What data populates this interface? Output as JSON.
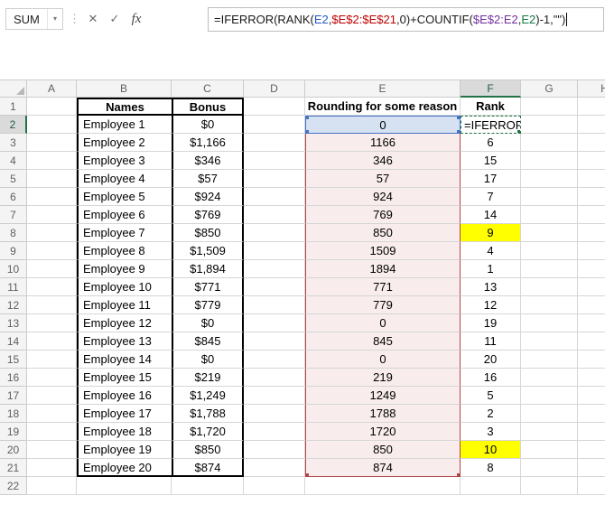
{
  "formula_bar": {
    "name_box_value": "SUM",
    "dropdown_icon": "▾",
    "splitter_icon": "⋮",
    "cancel_label": "✕",
    "enter_label": "✓",
    "insert_function_label": "fx",
    "formula_segments": [
      {
        "text": "=IFERROR(RANK(",
        "color": "#1a1a1a"
      },
      {
        "text": "E2",
        "color": "#2457c5"
      },
      {
        "text": ",",
        "color": "#1a1a1a"
      },
      {
        "text": "$E$2:$E$21",
        "color": "#c00000"
      },
      {
        "text": ",0)+COUNTIF(",
        "color": "#1a1a1a"
      },
      {
        "text": "$E$2:E2",
        "color": "#7030a0"
      },
      {
        "text": ",",
        "color": "#1a1a1a"
      },
      {
        "text": "E2",
        "color": "#107c41"
      },
      {
        "text": ")-1,\"\")",
        "color": "#1a1a1a"
      }
    ]
  },
  "grid": {
    "column_headers": [
      "A",
      "B",
      "C",
      "D",
      "E",
      "F",
      "G",
      "H"
    ],
    "row_headers": [
      "1",
      "2",
      "3",
      "4",
      "5",
      "6",
      "7",
      "8",
      "9",
      "10",
      "11",
      "12",
      "13",
      "14",
      "15",
      "16",
      "17",
      "18",
      "19",
      "20",
      "21",
      "22"
    ],
    "selected_column": "F",
    "selected_row_header": "2",
    "headers": {
      "names": "Names",
      "bonus": "Bonus",
      "rounding": "Rounding for some reason",
      "rank": "Rank"
    },
    "rows": [
      {
        "row": "2",
        "name": "Employee 1",
        "bonus": "$0",
        "rounded": "0",
        "rank": "=IFERROR",
        "editing": true,
        "e_highlight": "blue"
      },
      {
        "row": "3",
        "name": "Employee 2",
        "bonus": "$1,166",
        "rounded": "1166",
        "rank": "6"
      },
      {
        "row": "4",
        "name": "Employee 3",
        "bonus": "$346",
        "rounded": "346",
        "rank": "15"
      },
      {
        "row": "5",
        "name": "Employee 4",
        "bonus": "$57",
        "rounded": "57",
        "rank": "17"
      },
      {
        "row": "6",
        "name": "Employee 5",
        "bonus": "$924",
        "rounded": "924",
        "rank": "7"
      },
      {
        "row": "7",
        "name": "Employee 6",
        "bonus": "$769",
        "rounded": "769",
        "rank": "14"
      },
      {
        "row": "8",
        "name": "Employee 7",
        "bonus": "$850",
        "rounded": "850",
        "rank": "9",
        "rank_highlight": true
      },
      {
        "row": "9",
        "name": "Employee 8",
        "bonus": "$1,509",
        "rounded": "1509",
        "rank": "4"
      },
      {
        "row": "10",
        "name": "Employee 9",
        "bonus": "$1,894",
        "rounded": "1894",
        "rank": "1"
      },
      {
        "row": "11",
        "name": "Employee 10",
        "bonus": "$771",
        "rounded": "771",
        "rank": "13"
      },
      {
        "row": "12",
        "name": "Employee 11",
        "bonus": "$779",
        "rounded": "779",
        "rank": "12"
      },
      {
        "row": "13",
        "name": "Employee 12",
        "bonus": "$0",
        "rounded": "0",
        "rank": "19"
      },
      {
        "row": "14",
        "name": "Employee 13",
        "bonus": "$845",
        "rounded": "845",
        "rank": "11"
      },
      {
        "row": "15",
        "name": "Employee 14",
        "bonus": "$0",
        "rounded": "0",
        "rank": "20"
      },
      {
        "row": "16",
        "name": "Employee 15",
        "bonus": "$219",
        "rounded": "219",
        "rank": "16"
      },
      {
        "row": "17",
        "name": "Employee 16",
        "bonus": "$1,249",
        "rounded": "1249",
        "rank": "5"
      },
      {
        "row": "18",
        "name": "Employee 17",
        "bonus": "$1,788",
        "rounded": "1788",
        "rank": "2"
      },
      {
        "row": "19",
        "name": "Employee 18",
        "bonus": "$1,720",
        "rounded": "1720",
        "rank": "3"
      },
      {
        "row": "20",
        "name": "Employee 19",
        "bonus": "$850",
        "rounded": "850",
        "rank": "10",
        "rank_highlight": true
      },
      {
        "row": "21",
        "name": "Employee 20",
        "bonus": "$874",
        "rounded": "874",
        "rank": "8"
      }
    ]
  },
  "colors": {
    "grid_line": "#d6d6d6",
    "header_bg": "#f4f4f4",
    "header_border": "#cccccc",
    "header_text": "#5f5f5f",
    "sel_header_bg": "#dadada",
    "sel_header_accent": "#217346",
    "table_border": "#000000",
    "range_fill": "#f8ecec",
    "range_border": "#b34747",
    "ref_fill": "#d6e2f2",
    "ref_border": "#4472c4",
    "rank_highlight": "#ffff00",
    "edit_border": "#1e7145",
    "formula_box_border": "#bdbdbd"
  }
}
